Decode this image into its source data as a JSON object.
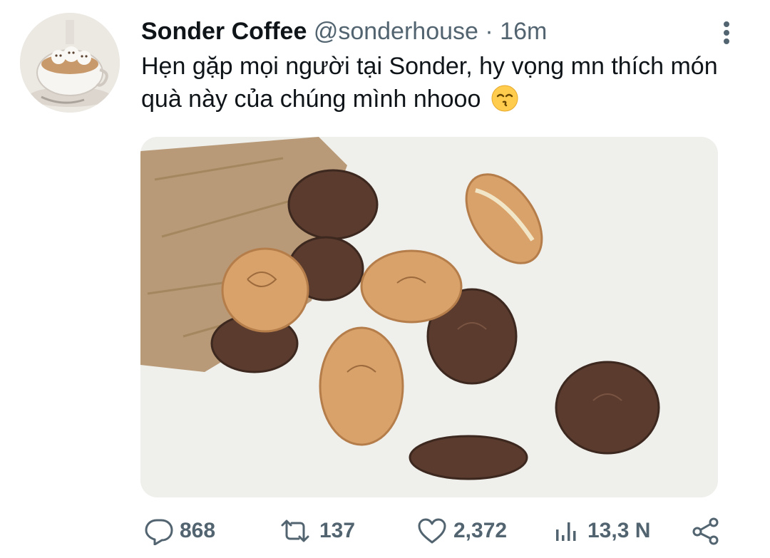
{
  "tweet": {
    "display_name": "Sonder Coffee",
    "handle": "@sonderhouse",
    "separator": "·",
    "time": "16m",
    "text": "Hẹn gặp mọi người tại Sonder, hy vọng mn thích món quà này của chúng mình nhooo",
    "emoji": "kissing-face-with-smiling-eyes"
  },
  "actions": {
    "replies": "868",
    "retweets": "137",
    "likes": "2,372",
    "views": "13,3 N"
  },
  "colors": {
    "text": "#0f1419",
    "muted": "#536471",
    "background": "#ffffff"
  }
}
